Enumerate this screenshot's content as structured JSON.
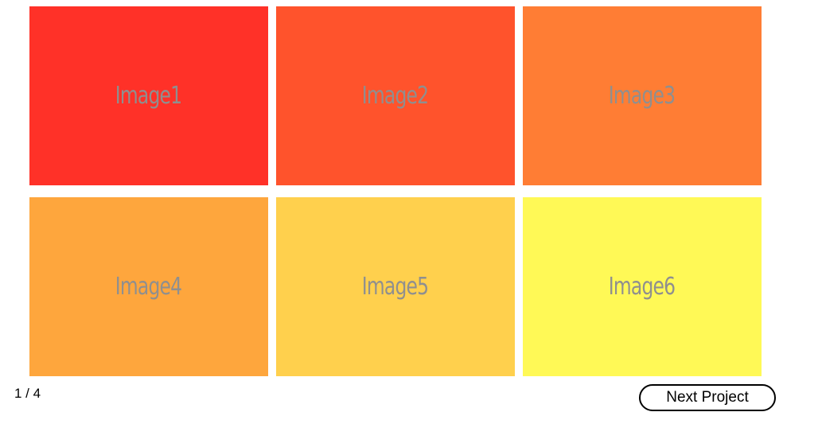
{
  "gallery": {
    "tiles": [
      {
        "label": "Image1",
        "color": "#ff3128"
      },
      {
        "label": "Image2",
        "color": "#ff532c"
      },
      {
        "label": "Image3",
        "color": "#ff7d34"
      },
      {
        "label": "Image4",
        "color": "#fea63d"
      },
      {
        "label": "Image5",
        "color": "#ffd04d"
      },
      {
        "label": "Image6",
        "color": "#fff956"
      }
    ]
  },
  "pagination": {
    "counter": "1 / 4"
  },
  "actions": {
    "next_project_label": "Next Project"
  }
}
